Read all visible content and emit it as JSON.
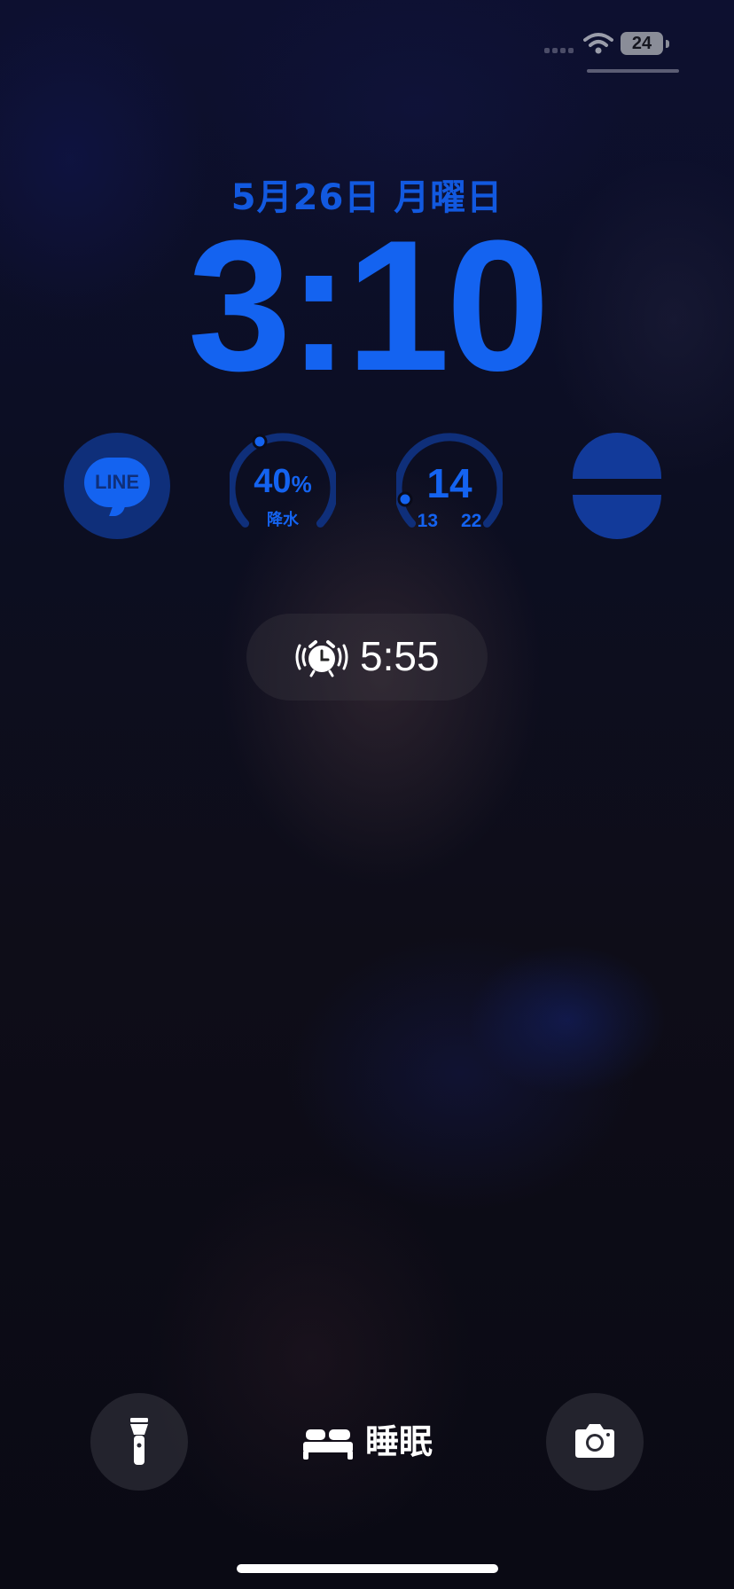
{
  "status_bar": {
    "battery": "24"
  },
  "lock_screen": {
    "date": "5月26日 月曜日",
    "time": "3:10"
  },
  "widgets": {
    "line": {
      "label": "LINE"
    },
    "precipitation": {
      "value": "40",
      "unit": "%",
      "label": "降水",
      "level_fraction": 0.4
    },
    "temperature": {
      "current": "14",
      "low": "13",
      "high": "22"
    }
  },
  "alarm": {
    "time": "5:55"
  },
  "bottom_bar": {
    "sleep_label": "睡眠"
  },
  "colors": {
    "accent": "#1463f0",
    "widget_dark": "#0f2f7a"
  }
}
